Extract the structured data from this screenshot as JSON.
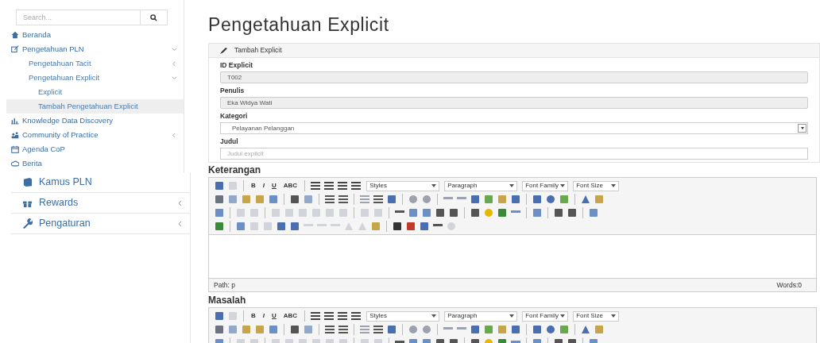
{
  "sidebar": {
    "search": {
      "placeholder": "Search..."
    },
    "menu": [
      {
        "label": "Beranda"
      },
      {
        "label": "Pengetahuan PLN",
        "expanded": true,
        "children": [
          {
            "label": "Pengetahuan Tacit",
            "expanded": false
          },
          {
            "label": "Pengetahuan Explicit",
            "expanded": true,
            "children": [
              {
                "label": "Explicit",
                "selected": false
              },
              {
                "label": "Tambah Pengetahuan Explicit",
                "selected": true
              }
            ]
          }
        ]
      },
      {
        "label": "Knowledge Data Discovery"
      },
      {
        "label": "Community of Practice",
        "expanded": false
      },
      {
        "label": "Agenda CoP"
      },
      {
        "label": "Berita"
      }
    ],
    "more_menu": [
      {
        "label": "Kamus PLN"
      },
      {
        "label": "Rewards",
        "expanded": false
      },
      {
        "label": "Pengaturan",
        "expanded": false
      }
    ]
  },
  "page_title": "Pengetahuan Explicit",
  "panel": {
    "title": "Tambah Explicit",
    "fields": [
      {
        "label": "ID Explicit",
        "kind": "readonly",
        "value": "T002"
      },
      {
        "label": "Penulis",
        "kind": "readonly",
        "value": "Eka Widya Wati"
      },
      {
        "label": "Kategori",
        "kind": "select",
        "value": "Pelayanan Pelanggan"
      },
      {
        "label": "Judul",
        "kind": "text",
        "placeholder": "Judul explicit"
      }
    ]
  },
  "editors": [
    {
      "label": "Keterangan",
      "format_buttons": [
        "B",
        "I",
        "U",
        "ABC"
      ],
      "dropdowns": [
        "Styles",
        "Paragraph",
        "Font Family",
        "Font Size"
      ],
      "path": "Path: p",
      "words": "Words:0"
    },
    {
      "label": "Masalah",
      "format_buttons": [
        "B",
        "I",
        "U",
        "ABC"
      ],
      "dropdowns": [
        "Styles",
        "Paragraph",
        "Font Family",
        "Font Size"
      ]
    }
  ]
}
